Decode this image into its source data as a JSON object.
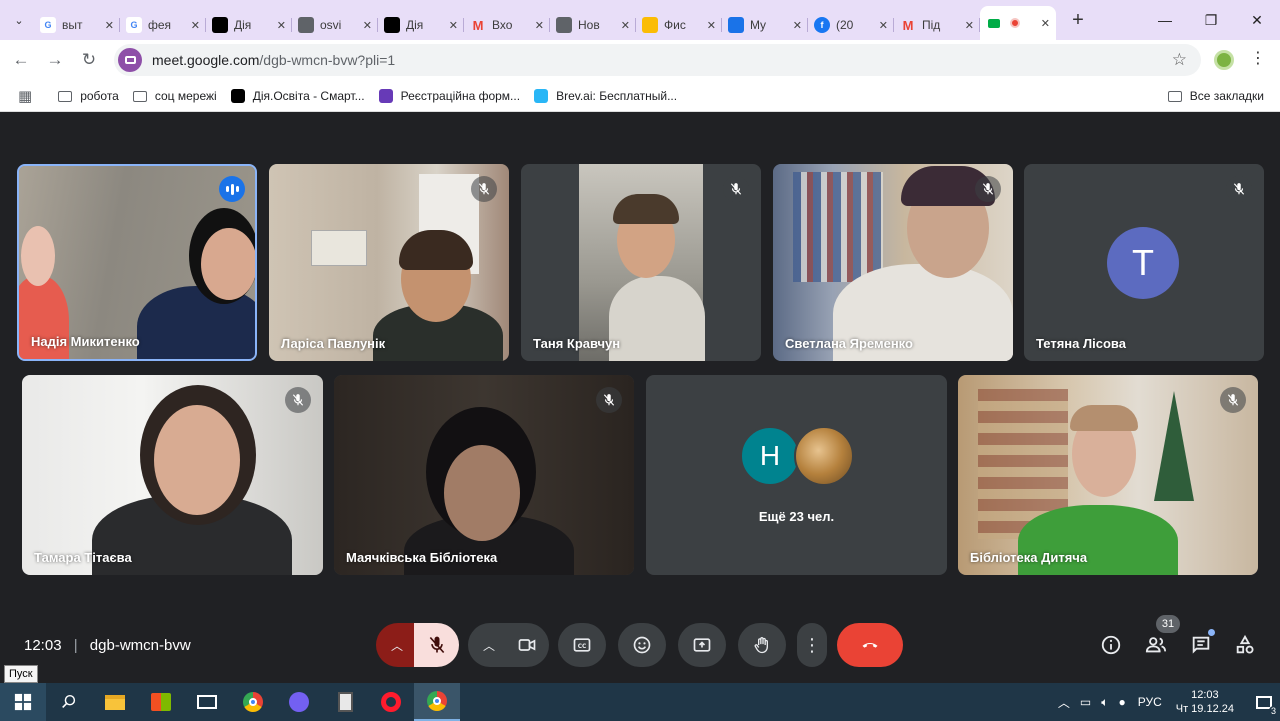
{
  "browser": {
    "tabs": [
      {
        "label": "выт",
        "icon": "google-icon",
        "color": "#ffffff"
      },
      {
        "label": "фея",
        "icon": "google-icon",
        "color": "#ffffff"
      },
      {
        "label": "Дія",
        "icon": "diia-icon",
        "color": "#000000"
      },
      {
        "label": "osvi",
        "icon": "globe-icon",
        "color": "#5f6368"
      },
      {
        "label": "Дія",
        "icon": "diia-icon",
        "color": "#000000"
      },
      {
        "label": "Вхо",
        "icon": "gmail-icon",
        "color": "#ea4335"
      },
      {
        "label": "Нов",
        "icon": "chrome-icon",
        "color": "#5f6368"
      },
      {
        "label": "Фис",
        "icon": "spark-icon",
        "color": "#fbbc04"
      },
      {
        "label": "My",
        "icon": "app-icon",
        "color": "#1a73e8"
      },
      {
        "label": "(20",
        "icon": "facebook-icon",
        "color": "#1877f2"
      },
      {
        "label": "Під",
        "icon": "gmail-icon",
        "color": "#ea4335"
      },
      {
        "label": "",
        "icon": "meet-icon",
        "color": "#00832d",
        "active": true
      }
    ],
    "url_host": "meet.google.com",
    "url_rest": "/dgb-wmcn-bvw?pli=1",
    "bookmarks": [
      {
        "label": "робота",
        "icon": "folder-icon"
      },
      {
        "label": "соц мережі",
        "icon": "folder-icon"
      },
      {
        "label": "Дія.Освіта - Смарт...",
        "icon": "diia-icon"
      },
      {
        "label": "Реєстраційна форм...",
        "icon": "forms-icon"
      },
      {
        "label": "Brev.ai: Бесплатный...",
        "icon": "brev-icon"
      }
    ],
    "all_bookmarks": "Все закладки"
  },
  "participants": [
    {
      "name": "Надія Микитенко"
    },
    {
      "name": "Ларіса Павлунік"
    },
    {
      "name": "Таня Кравчун"
    },
    {
      "name": "Светлана Яременко"
    },
    {
      "name": "Тетяна Лісова",
      "avatar_letter": "T"
    },
    {
      "name": "Тамара Тітаєва"
    },
    {
      "name": "Маячківська Бібліотека"
    },
    {
      "name": "Бібліотека Дитяча"
    }
  ],
  "others": {
    "avatar_letter": "H",
    "label": "Ещё 23 чел."
  },
  "meeting": {
    "time": "12:03",
    "code": "dgb-wmcn-bvw",
    "participants_count": "31"
  },
  "tooltip": "Пуск",
  "taskbar": {
    "lang": "РУС",
    "time": "12:03",
    "date": "Чт 19.12.24",
    "notifications": "3"
  }
}
